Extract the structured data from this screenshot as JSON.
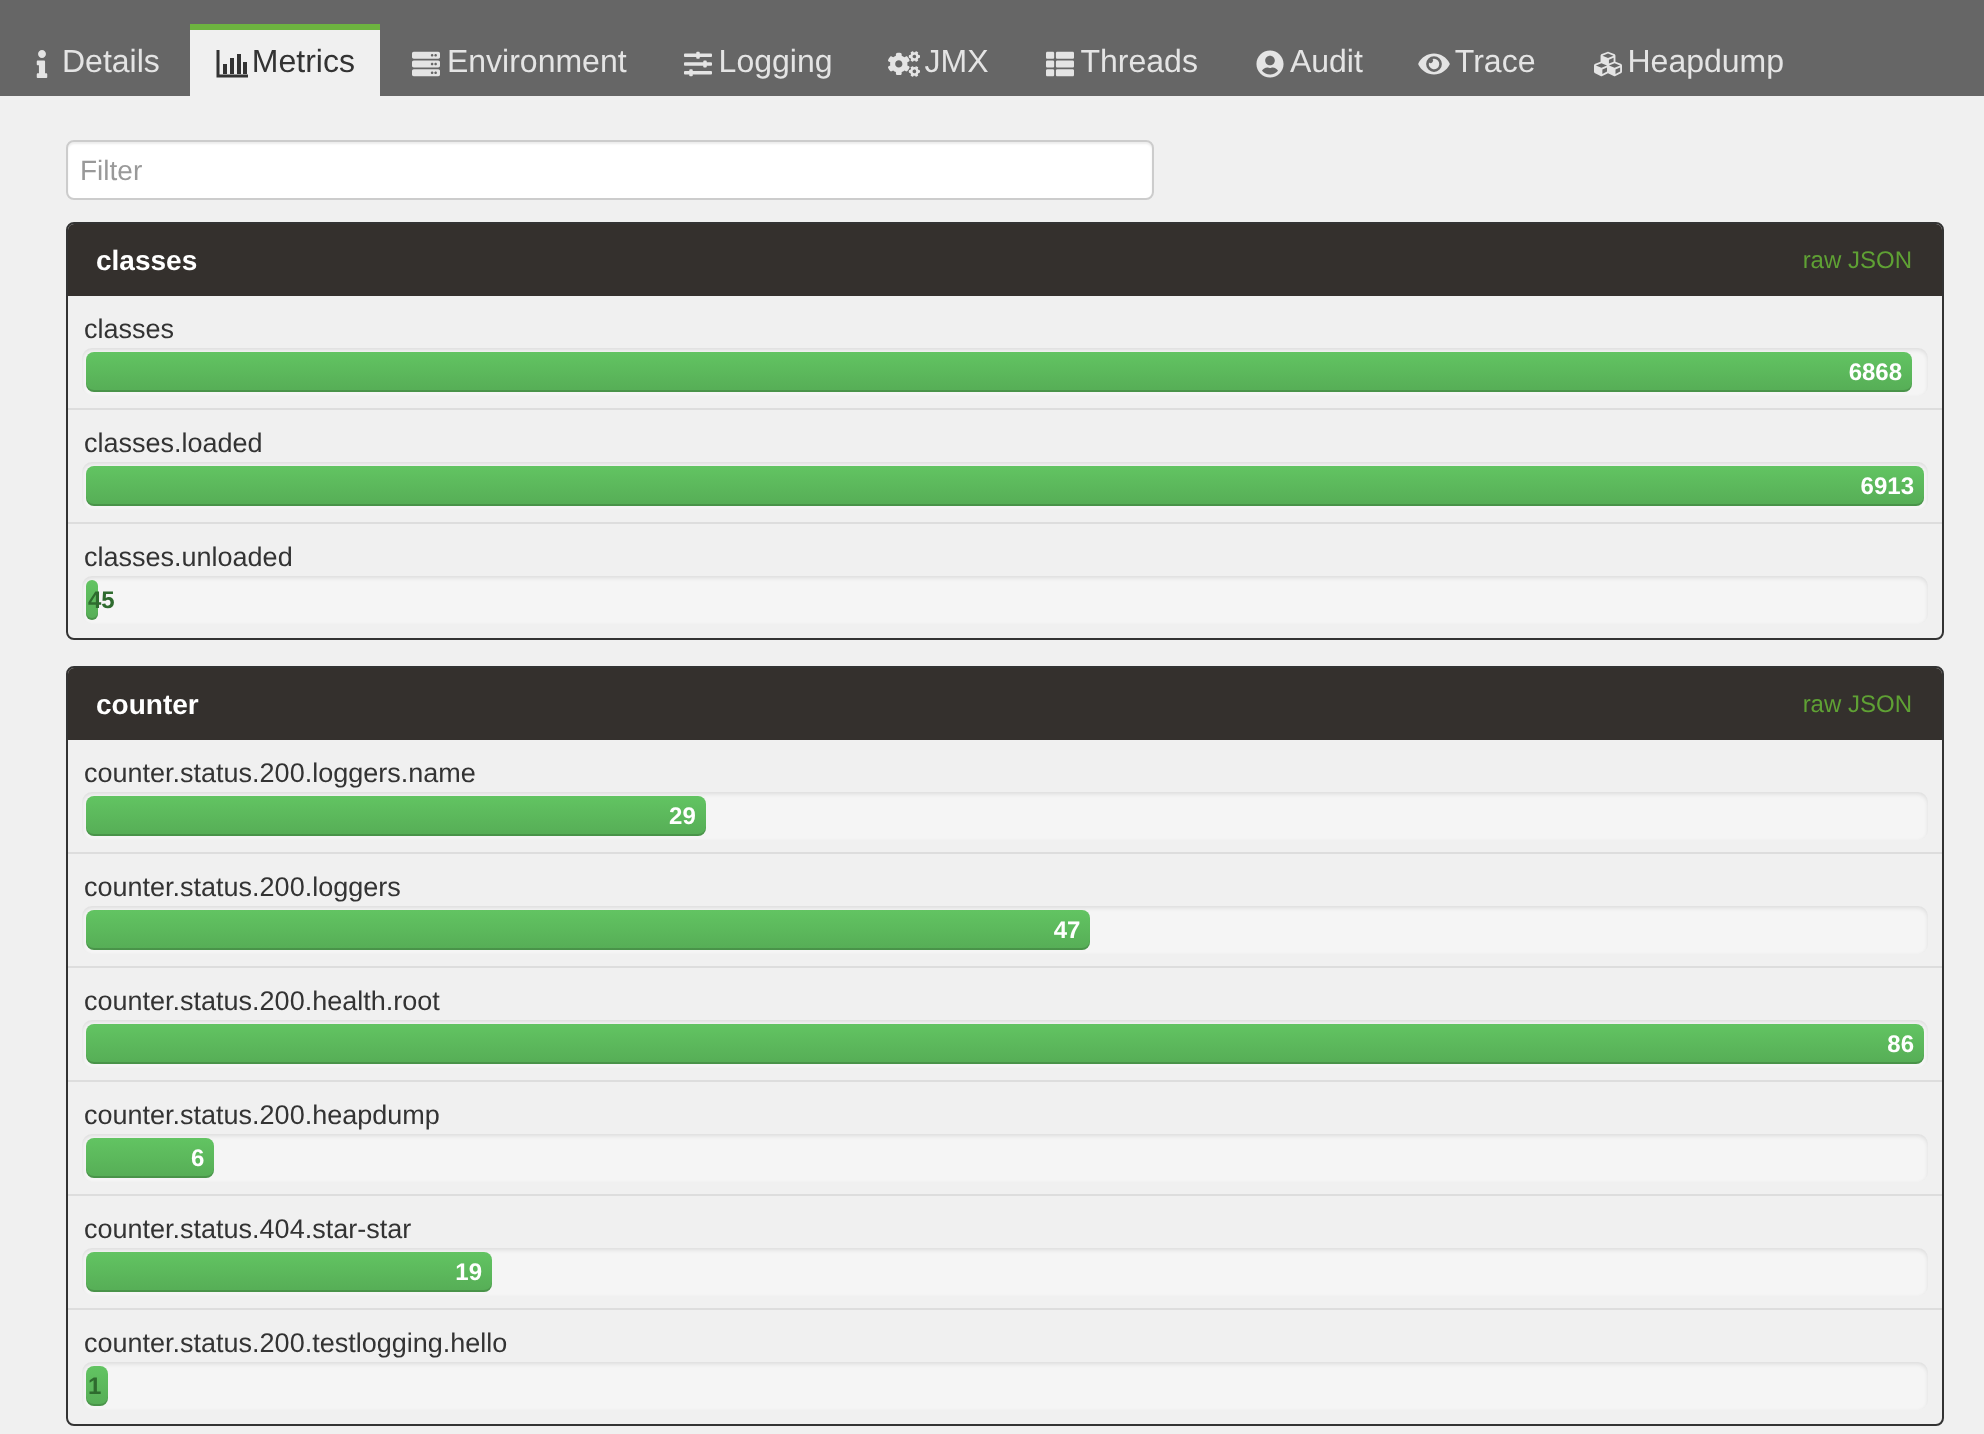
{
  "tabs": [
    {
      "label": "Details",
      "selected": false
    },
    {
      "label": "Metrics",
      "selected": true
    },
    {
      "label": "Environment",
      "selected": false
    },
    {
      "label": "Logging",
      "selected": false
    },
    {
      "label": "JMX",
      "selected": false
    },
    {
      "label": "Threads",
      "selected": false
    },
    {
      "label": "Audit",
      "selected": false
    },
    {
      "label": "Trace",
      "selected": false
    },
    {
      "label": "Heapdump",
      "selected": false
    }
  ],
  "filter": {
    "placeholder": "Filter"
  },
  "panels": [
    {
      "title": "classes",
      "link": "raw JSON",
      "metrics": [
        {
          "name": "classes",
          "value": "6868",
          "level": 0.9935
        },
        {
          "name": "classes.loaded",
          "value": "6913",
          "level": 1
        },
        {
          "name": "classes.unloaded",
          "value": "45",
          "level": 0.0065
        }
      ]
    },
    {
      "title": "counter",
      "link": "raw JSON",
      "metrics": [
        {
          "name": "counter.status.200.loggers.name",
          "value": "29",
          "level": 0.3372
        },
        {
          "name": "counter.status.200.loggers",
          "value": "47",
          "level": 0.5465
        },
        {
          "name": "counter.status.200.health.root",
          "value": "86",
          "level": 1
        },
        {
          "name": "counter.status.200.heapdump",
          "value": "6",
          "level": 0.0698
        },
        {
          "name": "counter.status.404.star-star",
          "value": "19",
          "level": 0.2209
        },
        {
          "name": "counter.status.200.testlogging.hello",
          "value": "1",
          "level": 0.0116
        }
      ]
    }
  ]
}
